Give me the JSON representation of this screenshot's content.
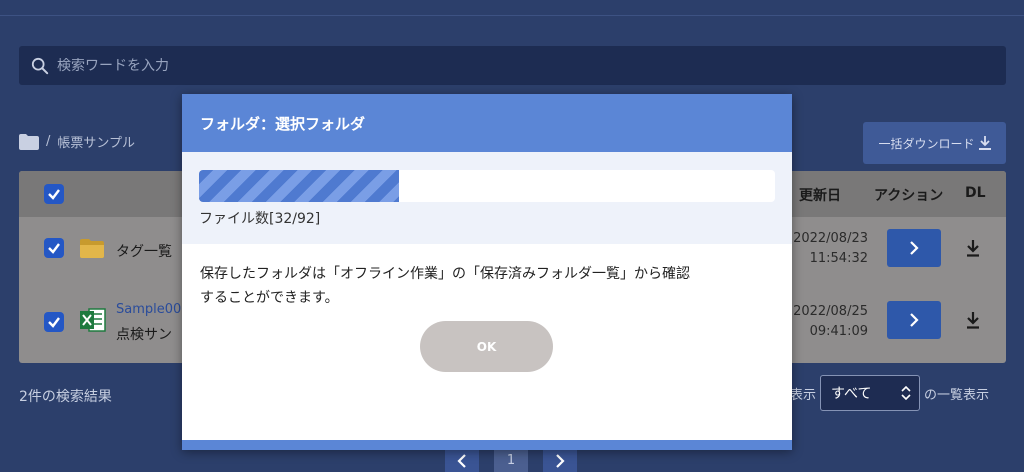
{
  "search": {
    "placeholder": "検索ワードを入力"
  },
  "breadcrumb": {
    "separator": "/",
    "current": "帳票サンプル"
  },
  "bulk_download": {
    "label": "一括ダウンロード"
  },
  "table": {
    "headers": {
      "updated": "更新日",
      "action": "アクション",
      "dl": "DL"
    },
    "rows": [
      {
        "name": "タグ一覧",
        "date": "2022/08/23",
        "time": "11:54:32",
        "type": "folder"
      },
      {
        "link": "Sample00",
        "name": "点検サン",
        "date": "2022/08/25",
        "time": "09:41:09",
        "type": "excel"
      }
    ]
  },
  "results": {
    "label": "2件の検索結果"
  },
  "perpage": {
    "prefix": "表示",
    "selected": "すべて",
    "suffix": "の一覧表示"
  },
  "pager": {
    "current": "1"
  },
  "modal": {
    "title": "フォルダ：選択フォルダ",
    "progress": {
      "done": 32,
      "total": 92
    },
    "count_label": "ファイル数[32/92]",
    "message_line1": "保存したフォルダは「オフライン作業」の「保存済みフォルダ一覧」から確認",
    "message_line2": "することができます。",
    "ok_label": "OK"
  },
  "colors": {
    "accent": "#5b86d6",
    "background": "#2c3f6b",
    "checkbox": "#2457c5"
  }
}
